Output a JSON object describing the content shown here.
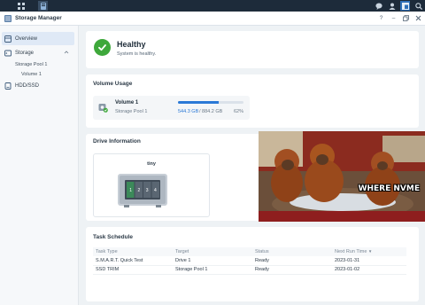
{
  "window": {
    "title": "Storage Manager"
  },
  "taskbar": {
    "icons": [
      "main-menu-icon",
      "storage-manager-icon",
      "chat-icon",
      "user-icon",
      "widgets-icon",
      "search-icon"
    ]
  },
  "window_controls": {
    "help": "?",
    "minimize": "–"
  },
  "sidebar": {
    "overview": "Overview",
    "storage": "Storage",
    "storage_pool": "Storage Pool 1",
    "volume": "Volume 1",
    "hdd_ssd": "HDD/SSD"
  },
  "health": {
    "title": "Healthy",
    "subtitle": "System is healthy.",
    "color": "#3ea83b"
  },
  "volume_usage": {
    "heading": "Volume Usage",
    "name": "Volume 1",
    "pool": "Storage Pool 1",
    "used": "544.3 GB",
    "total": "/ 884.2 GB",
    "percent_label": "62%",
    "percent": 62,
    "bar_color": "#2b79d6"
  },
  "drive_info": {
    "heading": "Drive Information",
    "device_name": "tiny",
    "bays": [
      "1",
      "2",
      "3",
      "4"
    ]
  },
  "meme": {
    "caption": "WHERE NVME"
  },
  "task_schedule": {
    "heading": "Task Schedule",
    "columns": [
      "Task Type",
      "Target",
      "Status",
      "Next Run Time"
    ],
    "rows": [
      [
        "S.M.A.R.T. Quick Test",
        "Drive 1",
        "Ready",
        "2023-01-31"
      ],
      [
        "SSD TRIM",
        "Storage Pool 1",
        "Ready",
        "2023-01-02"
      ]
    ]
  }
}
